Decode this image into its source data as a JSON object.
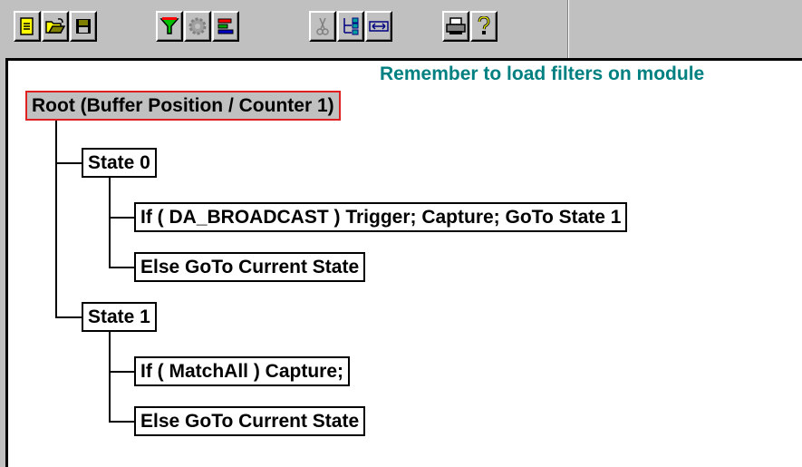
{
  "toolbar": {
    "buttons": [
      {
        "name": "new-icon"
      },
      {
        "name": "open-folder-icon"
      },
      {
        "name": "save-disk-icon"
      },
      {
        "name": "filter-funnel-icon"
      },
      {
        "name": "gear-disabled-icon"
      },
      {
        "name": "stacked-bars-icon"
      },
      {
        "name": "scissors-disabled-icon"
      },
      {
        "name": "tree-insert-icon"
      },
      {
        "name": "expand-width-icon"
      },
      {
        "name": "printer-icon"
      },
      {
        "name": "help-question-icon"
      }
    ]
  },
  "notice": "Remember to load filters on module",
  "tree": {
    "root": "Root (Buffer Position / Counter 1)",
    "state0": {
      "label": "State 0",
      "if_rule": "If ( DA_BROADCAST )  Trigger;  Capture; GoTo State 1",
      "else_rule": "Else GoTo Current State"
    },
    "state1": {
      "label": "State 1",
      "if_rule": "If ( MatchAll )  Capture;",
      "else_rule": "Else GoTo Current State"
    }
  },
  "colors": {
    "notice": "#008080",
    "root_border": "#e02020",
    "root_fill": "#c0c0c0"
  }
}
